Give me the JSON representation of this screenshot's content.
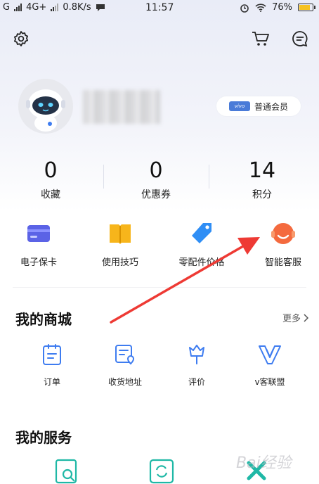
{
  "status_bar": {
    "carrier_left": "G",
    "network": "4G+",
    "speed": "0.8K/s",
    "time": "11:57",
    "battery": "76%"
  },
  "header": {
    "settings_icon": "gear-icon",
    "cart_icon": "cart-icon",
    "message_icon": "message-icon"
  },
  "profile": {
    "member_badge_logo": "vivo",
    "member_level": "普通会员"
  },
  "stats": [
    {
      "value": "0",
      "label": "收藏"
    },
    {
      "value": "0",
      "label": "优惠券"
    },
    {
      "value": "14",
      "label": "积分"
    }
  ],
  "quick_actions": [
    {
      "label": "电子保卡",
      "icon": "card-icon",
      "color": "#5b63e6"
    },
    {
      "label": "使用技巧",
      "icon": "book-icon",
      "color": "#f7b51b"
    },
    {
      "label": "零配件价格",
      "icon": "price-tag-icon",
      "color": "#2f8ef5"
    },
    {
      "label": "智能客服",
      "icon": "robot-face-icon",
      "color": "#f46a3e"
    }
  ],
  "mall": {
    "title": "我的商城",
    "more": "更多",
    "items": [
      {
        "label": "订单",
        "icon": "order-icon"
      },
      {
        "label": "收货地址",
        "icon": "address-icon"
      },
      {
        "label": "评价",
        "icon": "review-icon"
      },
      {
        "label": "v客联盟",
        "icon": "v-league-icon"
      }
    ]
  },
  "services": {
    "title": "我的服务"
  },
  "watermark": "Bai经验",
  "colors": {
    "accent_blue": "#3e7cf0",
    "annotation_arrow": "#ee3a34"
  }
}
